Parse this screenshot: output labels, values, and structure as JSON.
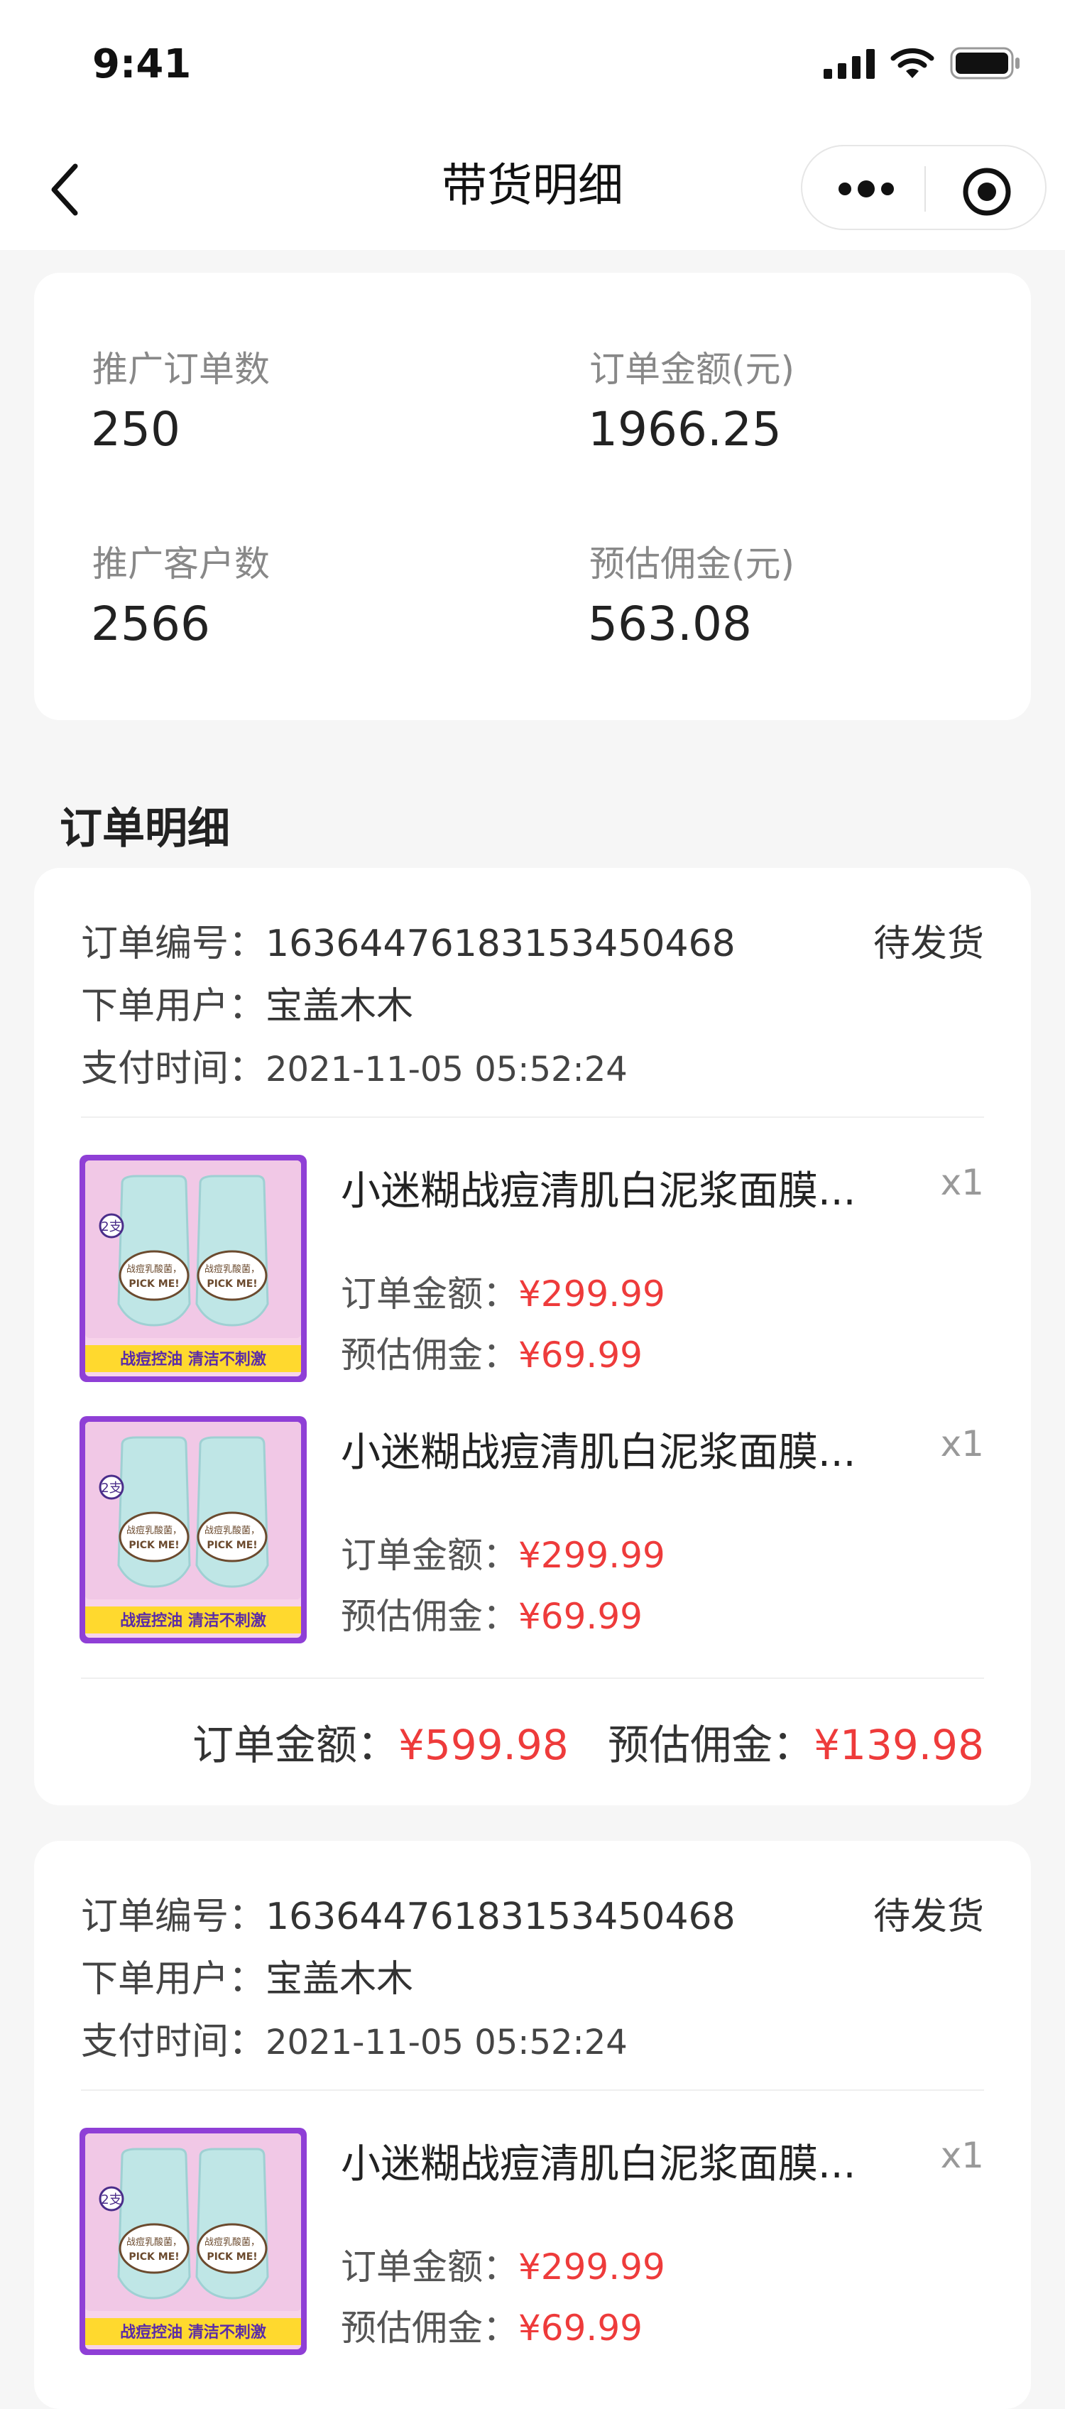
{
  "status_bar": {
    "time": "9:41"
  },
  "nav": {
    "title": "带货明细"
  },
  "stats": {
    "orders_label": "推广订单数",
    "orders_value": "250",
    "amount_label": "订单金额(元)",
    "amount_value": "1966.25",
    "customers_label": "推广客户数",
    "customers_value": "2566",
    "commission_label": "预估佣金(元)",
    "commission_value": "563.08"
  },
  "section": {
    "title": "订单明细"
  },
  "labels": {
    "order_no": "订单编号：",
    "user": "下单用户：",
    "pay_time": "支付时间：",
    "item_amount": "订单金额：",
    "item_commission": "预估佣金：",
    "total_amount": "订单金额：",
    "total_commission": "预估佣金："
  },
  "orders": [
    {
      "order_no": "1636447618315345046​8",
      "status": "待发货",
      "user": "宝盖木木",
      "pay_time": "2021-11-05 05:52:24",
      "items": [
        {
          "name": "小迷糊战痘清肌白泥浆面膜...",
          "qty": "x1",
          "amount": "¥299.99",
          "commission": "¥69.99"
        },
        {
          "name": "小迷糊战痘清肌白泥浆面膜...",
          "qty": "x1",
          "amount": "¥299.99",
          "commission": "¥69.99"
        }
      ],
      "total_amount": "¥599.98",
      "total_commission": "¥139.98"
    },
    {
      "order_no": "16364476183153450468",
      "status": "待发货",
      "user": "宝盖木木",
      "pay_time": "2021-11-05 05:52:24",
      "items": [
        {
          "name": "小迷糊战痘清肌白泥浆面膜...",
          "qty": "x1",
          "amount": "¥299.99",
          "commission": "¥69.99"
        }
      ]
    }
  ],
  "product_image": {
    "badge": "2支",
    "bubble_line1": "战痘乳酸菌，",
    "bubble_line2": "PICK ME!",
    "banner": "战痘控油 清洁不刺激"
  },
  "colors": {
    "accent_red": "#ee3b3b",
    "banner_yellow": "#ffd92e",
    "frame_purple": "#8f3fd6"
  }
}
